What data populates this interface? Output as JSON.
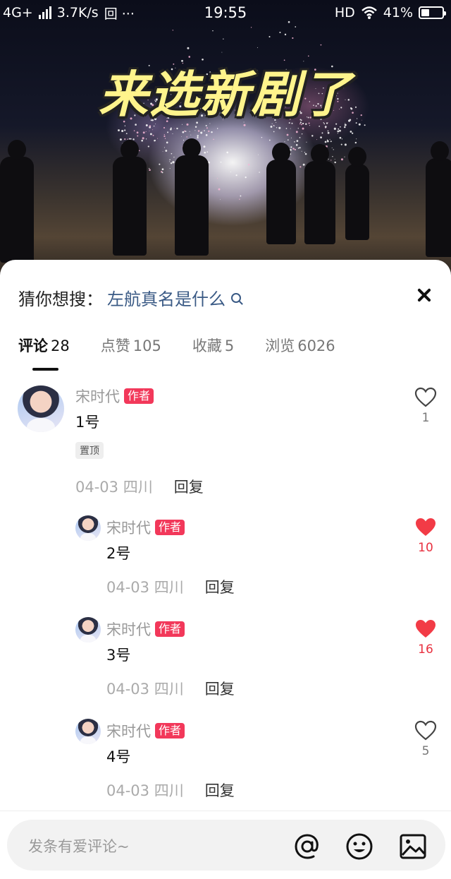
{
  "status": {
    "network": "4G+",
    "speed": "3.7K/s",
    "extra": "回 ···",
    "time": "19:55",
    "hd": "HD",
    "battery": "41%",
    "battery_level": 0.41
  },
  "video": {
    "title": "来选新剧了"
  },
  "sheet": {
    "suggest_label": "猜你想搜：",
    "suggest_keyword": "左航真名是什么",
    "tabs": [
      {
        "label": "评论",
        "count": "28"
      },
      {
        "label": "点赞",
        "count": "105"
      },
      {
        "label": "收藏",
        "count": "5"
      },
      {
        "label": "浏览",
        "count": "6026"
      }
    ]
  },
  "comments": [
    {
      "name": "宋时代",
      "badge": "作者",
      "text": "1号",
      "pin": "置顶",
      "date": "04-03 四川",
      "reply": "回复",
      "likes": "1",
      "liked": false
    },
    {
      "name": "宋时代",
      "badge": "作者",
      "text": "2号",
      "date": "04-03 四川",
      "reply": "回复",
      "likes": "10",
      "liked": true
    },
    {
      "name": "宋时代",
      "badge": "作者",
      "text": "3号",
      "date": "04-03 四川",
      "reply": "回复",
      "likes": "16",
      "liked": true
    },
    {
      "name": "宋时代",
      "badge": "作者",
      "text": "4号",
      "date": "04-03 四川",
      "reply": "回复",
      "likes": "5",
      "liked": false
    }
  ],
  "bottom": {
    "placeholder": "发条有爱评论~",
    "icons": [
      "at-icon",
      "emoji-icon",
      "image-icon"
    ]
  },
  "colors": {
    "accent": "#f2385a",
    "liked": "#e8303f",
    "keyword": "#3a5a85"
  }
}
